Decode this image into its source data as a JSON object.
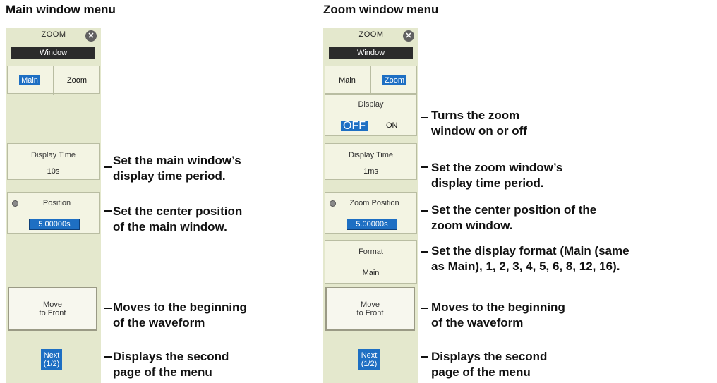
{
  "main_menu": {
    "heading": "Main window menu",
    "title": "ZOOM",
    "window_label": "Window",
    "tabs": [
      "Main",
      "Zoom"
    ],
    "display_time": {
      "label": "Display Time",
      "value": "10s"
    },
    "position": {
      "label": "Position",
      "value": "5.00000s"
    },
    "move_to_front": "Move\nto Front",
    "next": "Next\n(1/2)"
  },
  "zoom_menu": {
    "heading": "Zoom window menu",
    "title": "ZOOM",
    "window_label": "Window",
    "tabs": [
      "Main",
      "Zoom"
    ],
    "display": {
      "label": "Display",
      "off": "OFF",
      "on": "ON"
    },
    "display_time": {
      "label": "Display Time",
      "value": "1ms"
    },
    "zoom_position": {
      "label": "Zoom Position",
      "value": "5.00000s"
    },
    "format": {
      "label": "Format",
      "value": "Main"
    },
    "move_to_front": "Move\nto Front",
    "next": "Next\n(1/2)"
  },
  "annotations": {
    "main": {
      "display_time": "Set the main window’s\ndisplay time period.",
      "position": "Set the center position\nof the main window.",
      "move": "Moves to the beginning\nof the waveform",
      "next": "Displays the second\npage of the menu"
    },
    "zoom": {
      "display": "Turns the zoom\nwindow on or off",
      "display_time": "Set the zoom window’s\ndisplay time period.",
      "position": "Set the center position of the\nzoom window.",
      "format": "Set the display format (Main (same\nas Main), 1, 2, 3, 4, 5, 6, 8, 12, 16).",
      "move": "Moves to the beginning\nof the waveform",
      "next": "Displays the second\npage of the menu"
    }
  }
}
